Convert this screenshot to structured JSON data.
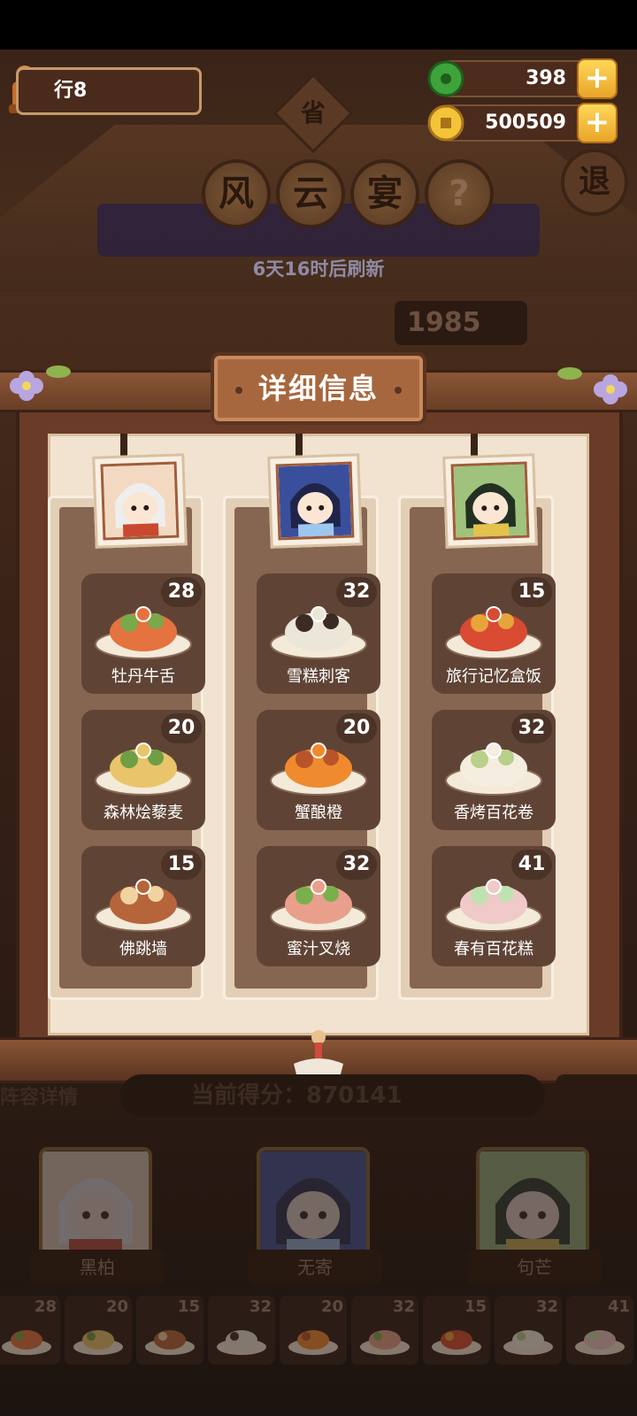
{
  "hud": {
    "rank_label": "行8",
    "jade": "398",
    "coins": "500509",
    "province_glyph": "省",
    "title_chars": [
      "风",
      "云",
      "宴"
    ],
    "help_glyph": "?",
    "exit_glyph": "退",
    "refresh_text": "6天16时后刷新",
    "bg_score": "1985"
  },
  "modal": {
    "title": "详细信息",
    "columns": [
      {
        "dishes": [
          {
            "name": "牡丹牛舌",
            "count": "28"
          },
          {
            "name": "森林烩藜麦",
            "count": "20"
          },
          {
            "name": "佛跳墙",
            "count": "15"
          }
        ]
      },
      {
        "dishes": [
          {
            "name": "雪糕刺客",
            "count": "32"
          },
          {
            "name": "蟹酿橙",
            "count": "20"
          },
          {
            "name": "蜜汁叉烧",
            "count": "32"
          }
        ]
      },
      {
        "dishes": [
          {
            "name": "旅行记忆盒饭",
            "count": "15"
          },
          {
            "name": "香烤百花卷",
            "count": "32"
          },
          {
            "name": "春有百花糕",
            "count": "41"
          }
        ]
      }
    ]
  },
  "team": {
    "lineup_label": "阵容详情",
    "score_text": "当前得分：870141",
    "members": [
      {
        "name": "黑柏"
      },
      {
        "name": "无寄"
      },
      {
        "name": "句芒"
      }
    ],
    "strip_counts": [
      "28",
      "20",
      "15",
      "32",
      "20",
      "32",
      "15",
      "32",
      "41"
    ]
  },
  "colors": {
    "panel_brown": "#876651",
    "dish_tile": "#5f4436",
    "paper": "#f1e3cf",
    "gold": "#e8a528",
    "jade_green": "#3ea33a"
  }
}
